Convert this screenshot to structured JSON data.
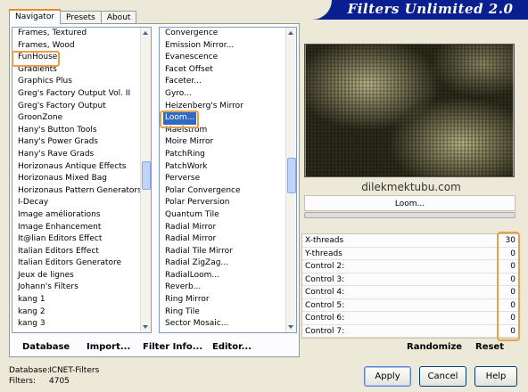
{
  "app_title": "Filters Unlimited 2.0",
  "tabs": [
    {
      "label": "Navigator",
      "active": true
    },
    {
      "label": "Presets",
      "active": false
    },
    {
      "label": "About",
      "active": false
    }
  ],
  "categories": [
    "Frames, Textured",
    "Frames, Wood",
    "FunHouse",
    "Gradients",
    "Graphics Plus",
    "Greg's Factory Output Vol. II",
    "Greg's Factory Output",
    "GroonZone",
    "Hany's Button Tools",
    "Hany's Power Grads",
    "Hany's Rave Grads",
    "Horizonaus Antique Effects",
    "Horizonaus Mixed Bag",
    "Horizonaus Pattern Generators",
    "I-Decay",
    "Image améliorations",
    "Image Enhancement",
    "It@lian Editors Effect",
    "Italian Editors Effect",
    "Italian Editors Generatore",
    "Jeux de lignes",
    "Johann's Filters",
    "kang 1",
    "kang 2",
    "kang 3"
  ],
  "selected_category": "FunHouse",
  "filters": [
    "Convergence",
    "Emission Mirror...",
    "Evanescence",
    "Facet Offset",
    "Faceter...",
    "Gyro...",
    "Heizenberg's Mirror",
    "Loom...",
    "Maelstrom",
    "Moire Mirror",
    "PatchRing",
    "PatchWork",
    "Perverse",
    "Polar Convergence",
    "Polar Perversion",
    "Quantum Tile",
    "Radial Mirror",
    "Radial Mirror",
    "Radial Tile Mirror",
    "Radial ZigZag...",
    "RadialLoom...",
    "Reverb...",
    "Ring Mirror",
    "Ring Tile",
    "Sector Mosaic..."
  ],
  "selected_filter": "Loom...",
  "watermark": "dilekmektubu.com",
  "filter_name": "Loom...",
  "controls": [
    {
      "label": "X-threads",
      "value": "30"
    },
    {
      "label": "Y-threads",
      "value": "0"
    },
    {
      "label": "Control 2:",
      "value": "0"
    },
    {
      "label": "Control 3:",
      "value": "0"
    },
    {
      "label": "Control 4:",
      "value": "0"
    },
    {
      "label": "Control 5:",
      "value": "0"
    },
    {
      "label": "Control 6:",
      "value": "0"
    },
    {
      "label": "Control 7:",
      "value": "0"
    }
  ],
  "toolbar": {
    "database": "Database",
    "import": "Import...",
    "filter_info": "Filter Info...",
    "editor": "Editor...",
    "randomize": "Randomize",
    "reset": "Reset"
  },
  "info": {
    "database_label": "Database:",
    "database_value": "ICNET-Filters",
    "filters_label": "Filters:",
    "filters_value": "4705"
  },
  "buttons": {
    "apply": "Apply",
    "cancel": "Cancel",
    "help": "Help"
  },
  "colors": {
    "banner": "#0a1f8f",
    "selection": "#316ac5",
    "highlight": "#e8a04a",
    "preview_base": "#2e2d1c",
    "preview_light": "#bdb98c"
  }
}
